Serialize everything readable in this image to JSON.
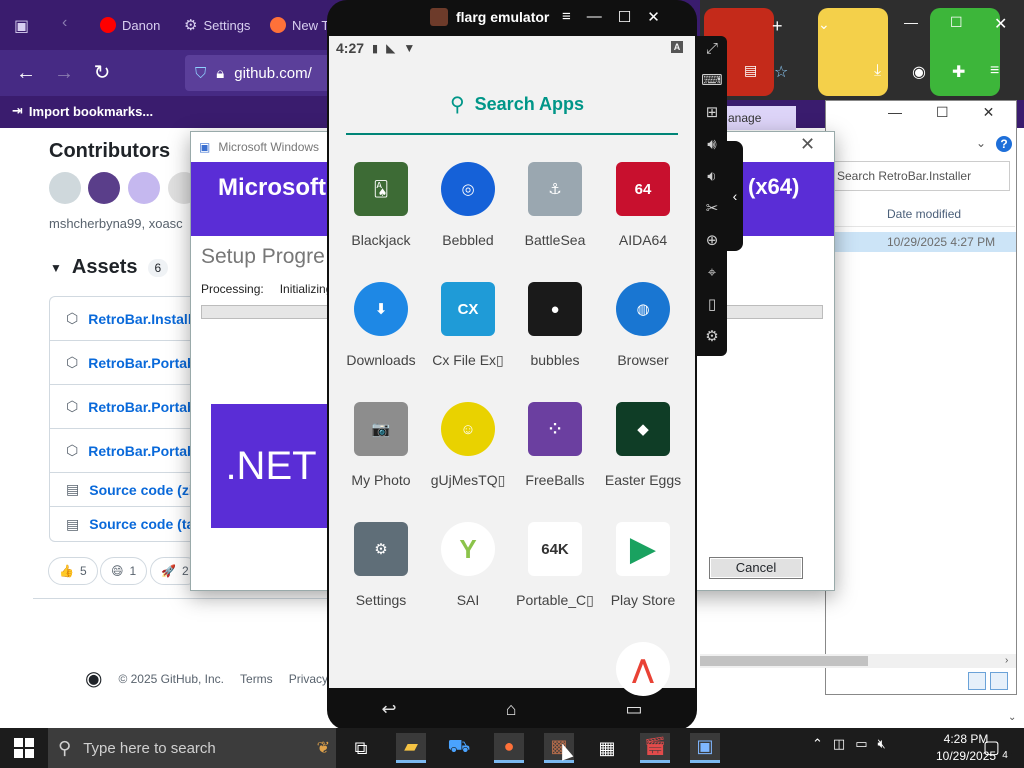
{
  "browser": {
    "tabs": [
      {
        "label": "Danon",
        "icon": "youtube-icon",
        "color": "#ff0000"
      },
      {
        "label": "Settings",
        "icon": "gear-icon",
        "color": "#d8cff0"
      },
      {
        "label": "New Ta",
        "icon": "firefox-icon",
        "color": "#ff7139"
      }
    ],
    "url": "github.com/",
    "import_bookmarks": "Import bookmarks..."
  },
  "github": {
    "contributors_title": "Contributors",
    "contributors_names": "mshcherbyna99, xoasc",
    "assets_title": "Assets",
    "assets_count": "6",
    "assets": [
      {
        "label": "RetroBar.Installe",
        "icon": "package-icon"
      },
      {
        "label": "RetroBar.Portab",
        "icon": "package-icon"
      },
      {
        "label": "RetroBar.Portab",
        "icon": "package-icon"
      },
      {
        "label": "RetroBar.Portab",
        "icon": "package-icon"
      },
      {
        "label": "Source code (zip",
        "icon": "file-zip-icon"
      },
      {
        "label": "Source code (ta",
        "icon": "file-zip-icon"
      }
    ],
    "reactions": [
      {
        "emoji": "👍",
        "count": "5"
      },
      {
        "emoji": "😄",
        "count": "1"
      },
      {
        "emoji": "🚀",
        "count": "2"
      }
    ],
    "footer": {
      "copyright": "© 2025 GitHub, Inc.",
      "terms": "Terms",
      "privacy": "Privacy"
    }
  },
  "setup": {
    "title": "Microsoft Windows",
    "banner_left": "Microsoft",
    "banner_right": "(x64)",
    "heading": "Setup Progre",
    "processing_label": "Processing:",
    "processing_value": "Initializing",
    "net_logo": ".NET",
    "cancel_label": "Cancel"
  },
  "explorer": {
    "search_placeholder": "Search RetroBar.Installer",
    "column_date": "Date modified",
    "row_date": "10/29/2025 4:27 PM",
    "manage_label": "anage"
  },
  "emulator": {
    "title": "flarg emulator",
    "status_time": "4:27",
    "status_badge": "A",
    "search_label": "Search Apps",
    "apps": [
      {
        "label": "Blackjack",
        "icon": "blackjack-icon",
        "color": "#3d6b35",
        "glyph": "🂡"
      },
      {
        "label": "Bebbled",
        "icon": "bebbled-icon",
        "color": "#1561d8",
        "glyph": "◎"
      },
      {
        "label": "BattleSea",
        "icon": "battlesea-icon",
        "color": "#9aa7b0",
        "glyph": "⚓"
      },
      {
        "label": "AIDA64",
        "icon": "aida64-icon",
        "color": "#c8102e",
        "glyph": "64"
      },
      {
        "label": "Downloads",
        "icon": "downloads-icon",
        "color": "#1e88e5",
        "glyph": "⬇"
      },
      {
        "label": "Cx File Ex▯",
        "icon": "cx-file-explorer-icon",
        "color": "#1f9bd7",
        "glyph": "CX"
      },
      {
        "label": "bubbles",
        "icon": "bubbles-icon",
        "color": "#1a1a1a",
        "glyph": "●"
      },
      {
        "label": "Browser",
        "icon": "browser-globe-icon",
        "color": "#1976d2",
        "glyph": "◍"
      },
      {
        "label": "My Photo",
        "icon": "camera-icon",
        "color": "#8d8d8d",
        "glyph": "📷"
      },
      {
        "label": "gUjMesTQ▯",
        "icon": "smiley-icon",
        "color": "#e9d200",
        "glyph": "☺"
      },
      {
        "label": "FreeBalls",
        "icon": "freeballs-icon",
        "color": "#6b3fa0",
        "glyph": "⁘"
      },
      {
        "label": "Easter Eggs",
        "icon": "easter-eggs-icon",
        "color": "#0f3d26",
        "glyph": "◆"
      },
      {
        "label": "Settings",
        "icon": "android-settings-icon",
        "color": "#5f6e78",
        "glyph": "⚙"
      },
      {
        "label": "SAI",
        "icon": "sai-icon",
        "color": "#ffffff",
        "glyph": "Y"
      },
      {
        "label": "Portable_C▯",
        "icon": "portable-c64-icon",
        "color": "#ffffff",
        "glyph": "64K"
      },
      {
        "label": "Play Store",
        "icon": "play-store-icon",
        "color": "#ffffff",
        "glyph": "▶"
      },
      {
        "label": "",
        "icon": "partial-app-icon",
        "color": "#ffffff",
        "glyph": "⋀"
      }
    ]
  },
  "taskbar": {
    "search_placeholder": "Type here to search",
    "time": "4:28 PM",
    "date": "10/29/2025",
    "notifications": "4"
  }
}
